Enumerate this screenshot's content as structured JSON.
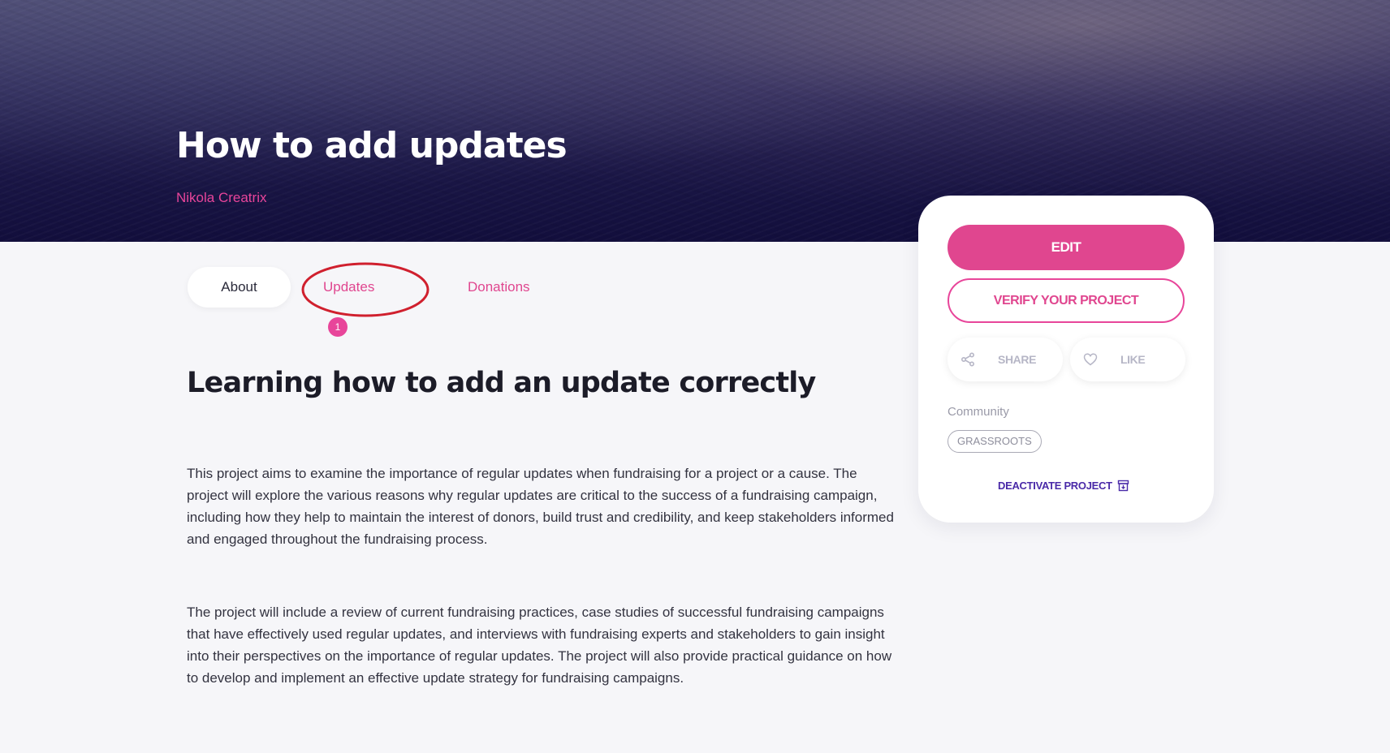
{
  "project": {
    "title": "How to add updates",
    "author": "Nikola Creatrix"
  },
  "tabs": {
    "about": "About",
    "updates": "Updates",
    "updates_badge": "1",
    "donations": "Donations"
  },
  "content": {
    "heading": "Learning how to add an update correctly",
    "paragraph_1": "This project aims to examine the importance of regular updates when fundraising for a project or a cause. The project will explore the various reasons why regular updates are critical to the success of a fundraising campaign, including how they help to maintain the interest of donors, build trust and credibility, and keep stakeholders informed and engaged throughout the fundraising process.",
    "paragraph_2": "The project will include a review of current fundraising practices, case studies of successful fundraising campaigns that have effectively used regular updates, and interviews with fundraising experts and stakeholders to gain insight into their perspectives on the importance of regular updates. The project will also provide practical guidance on how to develop and implement an effective update strategy for fundraising campaigns."
  },
  "sidebar": {
    "edit_label": "EDIT",
    "verify_label": "VERIFY YOUR PROJECT",
    "share_label": "SHARE",
    "share_icon": "share-icon",
    "like_label": "LIKE",
    "like_icon": "heart-icon",
    "community_label": "Community",
    "community_tag": "GRASSROOTS",
    "deactivate_label": "DEACTIVATE PROJECT",
    "deactivate_icon": "archive-icon"
  },
  "annotation": {
    "highlight_color": "#d0202e",
    "highlight_target": "tab-updates"
  },
  "colors": {
    "accent": "#e0468f",
    "deactivate": "#4a2aa8",
    "hero": "#120e3c"
  }
}
